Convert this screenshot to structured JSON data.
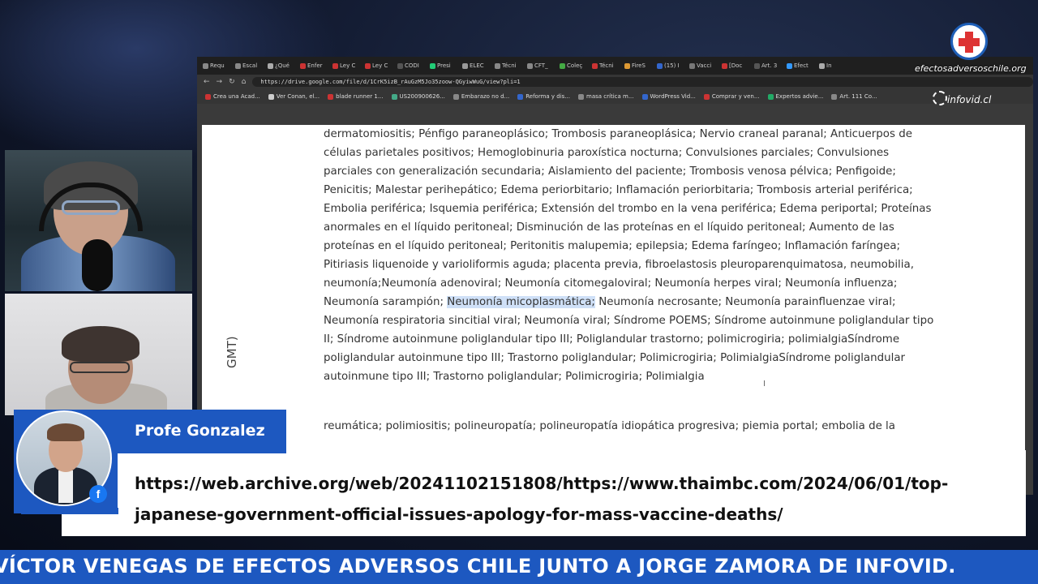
{
  "browser": {
    "tabs": [
      "Requ",
      "Escal",
      "¿Qué",
      "Enfer",
      "Ley C",
      "Ley C",
      "CODI",
      "Presi",
      "ELEC",
      "Técni",
      "CFT_",
      "Coleç",
      "Técni",
      "FireS",
      "(15) I",
      "Vacci",
      "[Doc",
      "Art. 3",
      "Efect",
      "In"
    ],
    "tab_colors": [
      "#888",
      "#888",
      "#aaa",
      "#c33",
      "#c33",
      "#c33",
      "#555",
      "#2c7",
      "#999",
      "#888",
      "#888",
      "#4a4",
      "#c33",
      "#d93",
      "#36c",
      "#777",
      "#c33",
      "#555",
      "#39f",
      "#aaa"
    ],
    "nav": {
      "back": "←",
      "forward": "→",
      "reload": "↻",
      "home": "⌂"
    },
    "url": "https://drive.google.com/file/d/1CrK5izB_rAuGzM5Jo35zoow-QGyiwWuG/view?pli=1",
    "bookmarks": [
      {
        "label": "Crea una Acad...",
        "color": "#c33"
      },
      {
        "label": "Ver Conan, el...",
        "color": "#ccc"
      },
      {
        "label": "blade runner 1...",
        "color": "#c33"
      },
      {
        "label": "US200900626...",
        "color": "#4a8"
      },
      {
        "label": "Embarazo no d...",
        "color": "#888"
      },
      {
        "label": "Reforma y dis...",
        "color": "#36c"
      },
      {
        "label": "masa crítica m...",
        "color": "#888"
      },
      {
        "label": "WordPress Vid...",
        "color": "#36c"
      },
      {
        "label": "Comprar y ven...",
        "color": "#c33"
      },
      {
        "label": "Expertos advie...",
        "color": "#2a6"
      },
      {
        "label": "Art. 111 Co...",
        "color": "#888"
      }
    ]
  },
  "document": {
    "before_highlight": "dermatomiositis; Pénfigo paraneoplásico; Trombosis paraneoplásica; Nervio craneal paranal; Anticuerpos de células parietales positivos; Hemoglobinuria paroxística nocturna; Convulsiones parciales; Convulsiones parciales con generalización secundaria; Aislamiento del paciente; Trombosis venosa pélvica; Penfigoide; Penicitis; Malestar perihepático; Edema periorbitario; Inflamación periorbitaria; Trombosis arterial periférica; Embolia periférica; Isquemia periférica; Extensión del trombo en la vena periférica; Edema periportal; Proteínas anormales en el líquido peritoneal; Disminución de las proteínas en el líquido peritoneal; Aumento de las proteínas en el líquido peritoneal; Peritonitis malupemia; epilepsia; Edema faríngeo; Inflamación faríngea; Pitiriasis liquenoide y varioliformis aguda; placenta previa, fibroelastosis pleuroparenquimatosa, neumobilia, neumonía;Neumonía adenoviral; Neumonía citomegaloviral; Neumonía herpes viral; Neumonía influenza; Neumonía sarampión; ",
    "highlight": "Neumonía micoplasmática;",
    "after_highlight": " Neumonía necrosante; Neumonía parainfluenzae viral; Neumonía respiratoria sincitial viral; Neumonía viral; Síndrome POEMS; Síndrome autoinmune poliglandular tipo II; Síndrome autoinmune poliglandular tipo III; Poliglandular trastorno; polimicrogiria; polimialgiaSíndrome poliglandular autoinmune tipo III; Trastorno poliglandular; Polimicrogiria; PolimialgiaSíndrome poliglandular autoinmune tipo III; Trastorno poliglandular; Polimicrogiria; Polimialgia",
    "next_line": "reumática; polimiositis; polineuropatía; polineuropatía idiopática progresiva; piemia portal; embolia de la",
    "rotated_label": "GMT)"
  },
  "watermark": {
    "site": "efectosadversoschile.org",
    "brand": "infovid.cl"
  },
  "lower_third": {
    "name": "Profe Gonzalez",
    "link": "https://web.archive.org/web/20241102151808/https://www.thaimbc.com/2024/06/01/top-japanese-government-official-issues-apology-for-mass-vaccine-deaths/",
    "social_icon": "f"
  },
  "ticker": {
    "text": "VÍCTOR VENEGAS DE EFECTOS ADVERSOS CHILE JUNTO A JORGE ZAMORA DE INFOVID."
  }
}
